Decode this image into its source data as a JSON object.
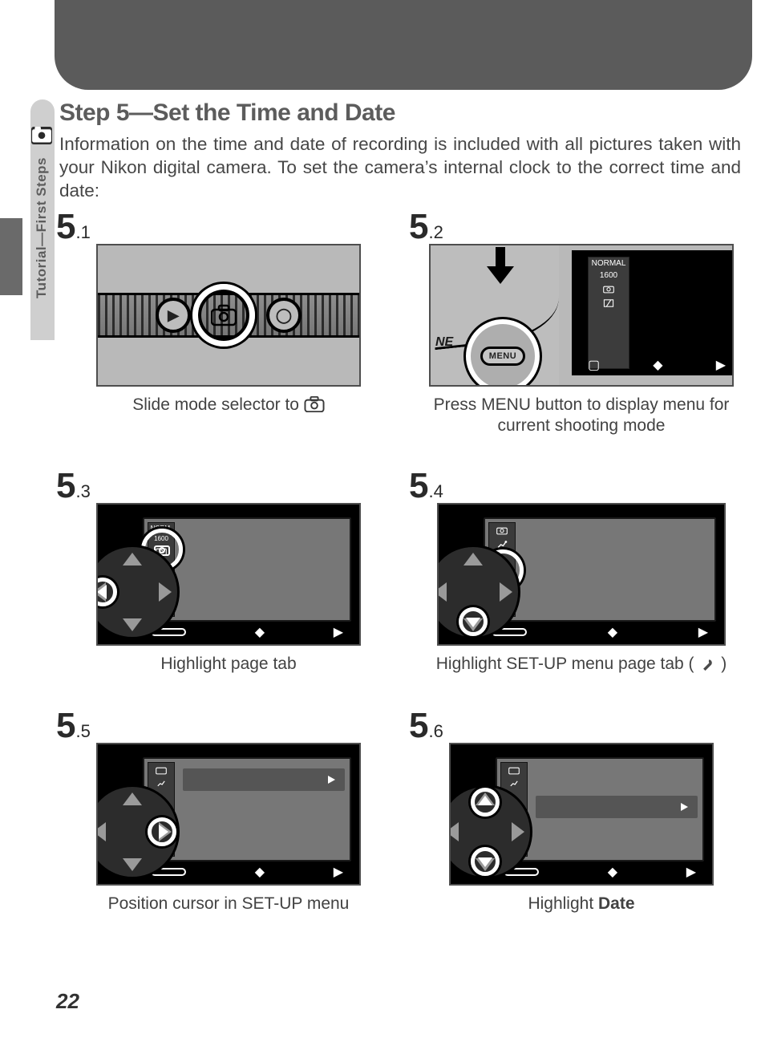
{
  "sidetab": {
    "label": "Tutorial—First Steps"
  },
  "heading": "Step 5—Set the Time and Date",
  "intro": "Information on the time and date of recording is included with all pictures taken with your Nikon digital camera.  To set the camera’s internal clock to the correct time and date:",
  "steps": {
    "s1": {
      "major": "5",
      "minor": ".1",
      "caption": "Slide mode selector to "
    },
    "s2": {
      "major": "5",
      "minor": ".2",
      "caption": "Press MENU button to display menu for current shooting mode"
    },
    "s3": {
      "major": "5",
      "minor": ".3",
      "caption": "Highlight page tab"
    },
    "s4": {
      "major": "5",
      "minor": ".4",
      "caption_pre": "Highlight SET-UP menu page tab (",
      "caption_post": ")"
    },
    "s5": {
      "major": "5",
      "minor": ".5",
      "caption": "Position cursor in SET-UP menu"
    },
    "s6": {
      "major": "5",
      "minor": ".6",
      "caption_pre": "Highlight ",
      "caption_bold": "Date"
    }
  },
  "screen": {
    "normal": "NORMAL",
    "res": "1600"
  },
  "menu_button": {
    "label": "MENU",
    "ne": "NE"
  },
  "page_number": "22"
}
